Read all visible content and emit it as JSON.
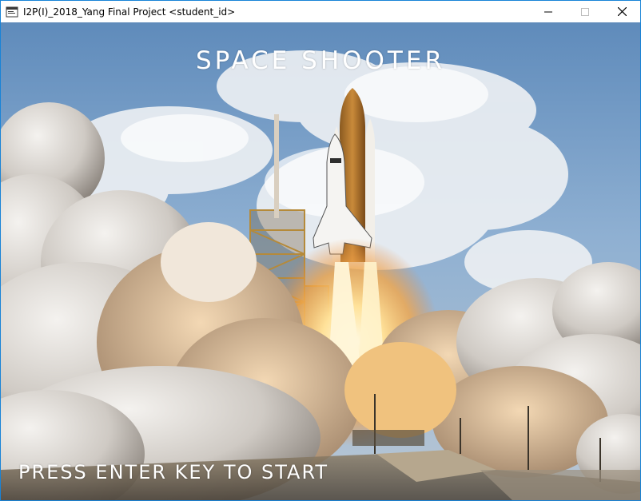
{
  "window": {
    "title": "I2P(I)_2018_Yang Final Project <student_id>",
    "border_color": "#1883d7"
  },
  "controls": {
    "minimize_icon": "minimize-icon",
    "maximize_icon": "maximize-icon",
    "close_icon": "close-icon"
  },
  "game": {
    "title": "SPACE SHOOTER",
    "prompt": "PRESS ENTER KEY TO START",
    "text_color": "#ffffff"
  },
  "background": {
    "scene": "space-shuttle-launch",
    "sky_color": "#6a93bf",
    "smoke_color": "#e8e2d8",
    "fire_color": "#ffd27a"
  }
}
